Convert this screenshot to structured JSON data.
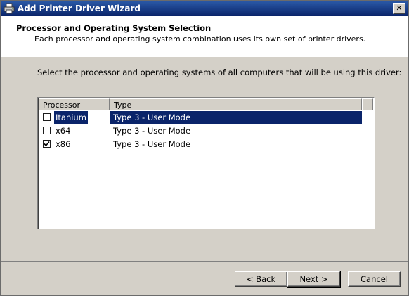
{
  "window": {
    "title": "Add Printer Driver Wizard",
    "close_label": "✕"
  },
  "header": {
    "title": "Processor and Operating System Selection",
    "subtitle": "Each processor and operating system combination uses its own set of printer drivers."
  },
  "instruction": "Select the processor and operating systems of all computers that will be using this driver:",
  "list": {
    "columns": [
      "Processor",
      "Type"
    ],
    "rows": [
      {
        "processor": "Itanium",
        "type": "Type 3 - User Mode",
        "checked": false,
        "selected": true
      },
      {
        "processor": "x64",
        "type": "Type 3 - User Mode",
        "checked": false,
        "selected": false
      },
      {
        "processor": "x86",
        "type": "Type 3 - User Mode",
        "checked": true,
        "selected": false
      }
    ]
  },
  "buttons": {
    "back": "< Back",
    "next": "Next >",
    "cancel": "Cancel"
  },
  "colors": {
    "title_bar": "#0a246a",
    "selection": "#0a246a",
    "face": "#d4d0c8"
  }
}
